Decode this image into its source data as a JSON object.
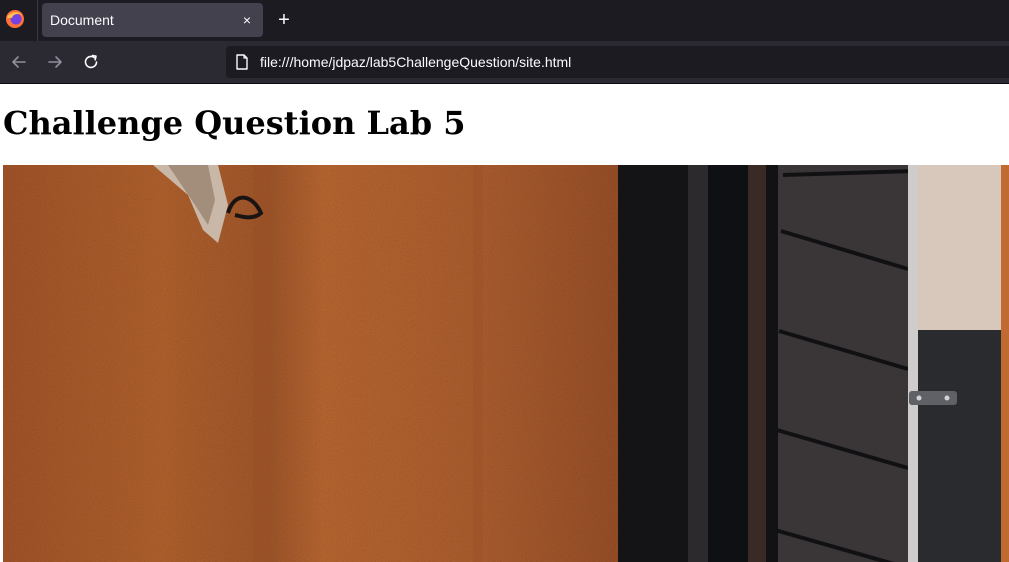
{
  "browser": {
    "tab": {
      "title": "Document",
      "close_label": "×"
    },
    "new_tab_label": "+",
    "url": "file:///home/jdpaz/lab5ChallengeQuestion/site.html"
  },
  "page": {
    "heading": "Challenge Question Lab 5"
  },
  "colors": {
    "tabbar_bg": "#1c1b22",
    "active_tab_bg": "#42414d",
    "navbar_bg": "#2b2a33",
    "wall_orange": "#b8652e",
    "shutter_dark": "#2e2b2d"
  },
  "icons": {
    "browser_logo": "firefox-logo-icon",
    "back": "arrow-left-icon",
    "forward": "arrow-right-icon",
    "reload": "reload-icon",
    "page": "page-icon"
  }
}
